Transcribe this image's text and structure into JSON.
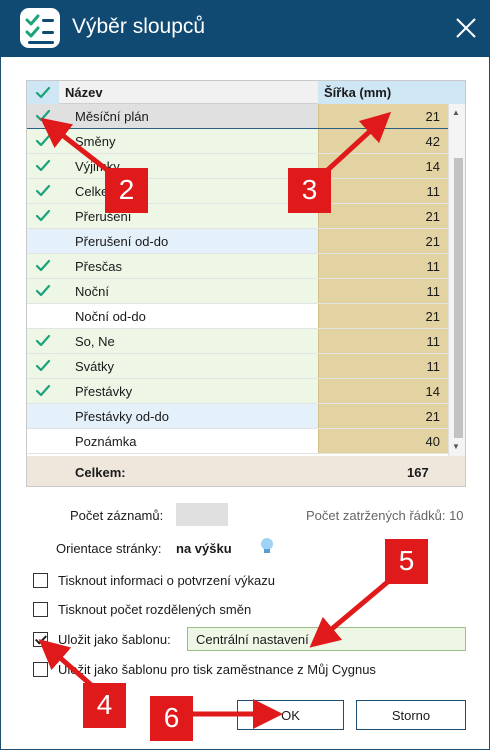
{
  "window": {
    "title": "Výběr sloupců"
  },
  "colors": {
    "titlebar": "#104a72",
    "check": "#1aa37a",
    "width_cell": "#e3d2a2",
    "annotation": "#e01a1a"
  },
  "grid": {
    "header": {
      "name": "Název",
      "width": "Šířka (mm)"
    },
    "rows": [
      {
        "name": "Měsíční plán",
        "width": "21",
        "checked": true
      },
      {
        "name": "Směny",
        "width": "42",
        "checked": true
      },
      {
        "name": "Výjimky",
        "width": "14",
        "checked": true
      },
      {
        "name": "Celkem",
        "width": "11",
        "checked": true
      },
      {
        "name": "Přerušení",
        "width": "21",
        "checked": true
      },
      {
        "name": "Přerušení od-do",
        "width": "21",
        "checked": false
      },
      {
        "name": "Přesčas",
        "width": "11",
        "checked": true
      },
      {
        "name": "Noční",
        "width": "11",
        "checked": true
      },
      {
        "name": "Noční od-do",
        "width": "21",
        "checked": false
      },
      {
        "name": "So, Ne",
        "width": "11",
        "checked": true
      },
      {
        "name": "Svátky",
        "width": "11",
        "checked": true
      },
      {
        "name": "Přestávky",
        "width": "14",
        "checked": true
      },
      {
        "name": "Přestávky od-do",
        "width": "21",
        "checked": false
      },
      {
        "name": "Poznámka",
        "width": "40",
        "checked": false
      }
    ],
    "total_label": "Celkem:",
    "total_value": "167"
  },
  "records_label": "Počet záznamů:",
  "checked_rows_label": "Počet zatržených řádků: 10",
  "orientation": {
    "label": "Orientace stránky:",
    "value": "na výšku",
    "icon": "lightbulb-icon"
  },
  "options": {
    "print_confirmation": "Tisknout informaci o potvrzení výkazu",
    "print_split_shifts": "Tisknout počet rozdělených směn",
    "save_as_template": "Uložit jako šablonu:",
    "template_value": "Centrální nastavení",
    "save_template_employee": "Uložit jako šablonu pro tisk zaměstnance z Můj Cygnus"
  },
  "buttons": {
    "ok": "OK",
    "cancel": "Storno"
  },
  "annotations": {
    "b2": "2",
    "b3": "3",
    "b4": "4",
    "b5": "5",
    "b6": "6"
  }
}
